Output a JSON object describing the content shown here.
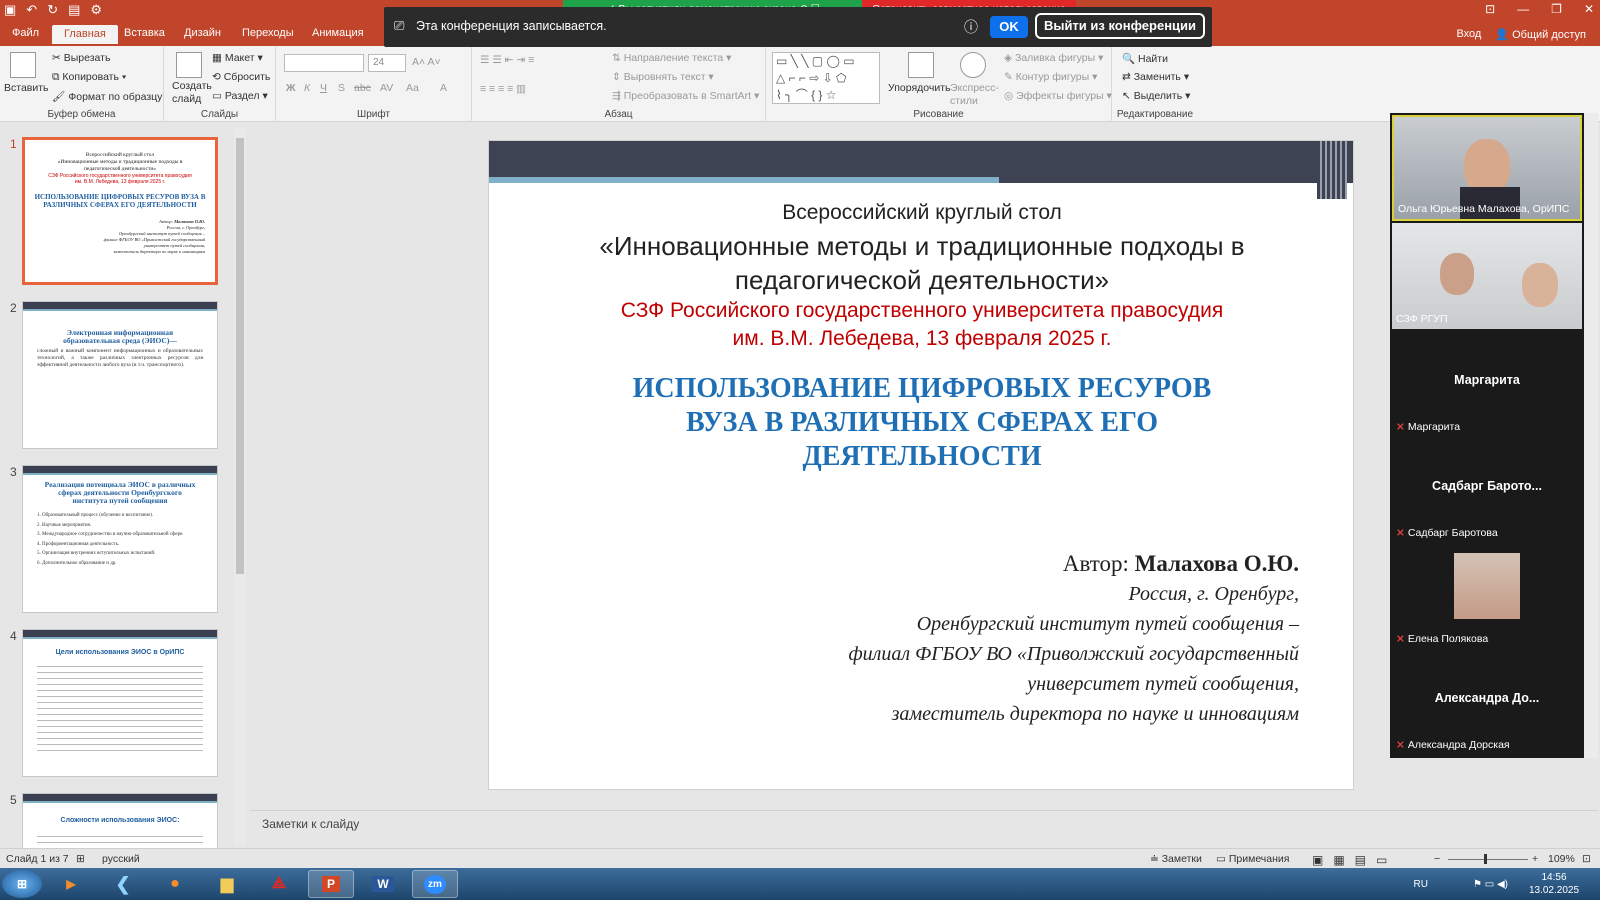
{
  "window": {
    "qat_icons": [
      "save-icon",
      "undo-icon",
      "redo-icon",
      "start-slideshow-icon",
      "customize-icon"
    ],
    "controls": [
      "ribbon-display-icon",
      "minimize-icon",
      "maximize-icon",
      "close-icon"
    ]
  },
  "zoom_share": {
    "green_text": "Вы запустили демонстрацию экрана",
    "red_text": "Остановить совместное использование"
  },
  "notice": {
    "text": "Эта конференция записывается.",
    "ok": "OK",
    "leave": "Выйти из конференции"
  },
  "tabs": {
    "file": "Файл",
    "home": "Главная",
    "insert": "Вставка",
    "design": "Дизайн",
    "transitions": "Переходы",
    "animation": "Анимация",
    "signin": "Вход",
    "share": "Общий доступ"
  },
  "ribbon": {
    "clipboard": {
      "label": "Буфер обмена",
      "paste": "Вставить",
      "cut": "Вырезать",
      "copy": "Копировать",
      "format": "Формат по образцу"
    },
    "slides": {
      "label": "Слайды",
      "new_slide": "Создать слайд",
      "layout": "Макет",
      "reset": "Сбросить",
      "section": "Раздел"
    },
    "font": {
      "label": "Шрифт",
      "size": "24",
      "bold": "Ж",
      "italic": "К",
      "underline": "Ч",
      "shadow": "S",
      "strike": "abc",
      "spacing": "AV",
      "case": "Aa"
    },
    "paragraph": {
      "label": "Абзац",
      "direction": "Направление текста",
      "align": "Выровнять текст",
      "smartart": "Преобразовать в SmartArt"
    },
    "drawing": {
      "label": "Рисование",
      "arrange": "Упорядочить",
      "styles": "Экспресс-стили",
      "fill": "Заливка фигуры",
      "outline": "Контур фигуры",
      "effects": "Эффекты фигуры"
    },
    "editing": {
      "label": "Редактирование",
      "find": "Найти",
      "replace": "Заменить",
      "select": "Выделить"
    }
  },
  "thumbnails": [
    {
      "num": "1"
    },
    {
      "num": "2",
      "title": "Электронная информационная образовательная среда (ЭИОС)—",
      "body": "сложный и важный компонент информационных и образовательных технологий, а также различных электронных ресурсов для эффективной деятельности любого вуза (в т.ч. транспортного)."
    },
    {
      "num": "3",
      "title": "Реализация потенциала ЭИОС в различных сферах деятельности Оренбургского института путей сообщения",
      "items": [
        "Образовательный процесс (обучение и воспитание).",
        "Научные мероприятия.",
        "Международное сотрудничество в научно-образовательной сфере.",
        "Профориентационная деятельность.",
        "Организация внутренних вступительных испытаний.",
        "Дополнительное образование и др."
      ]
    },
    {
      "num": "4",
      "title": "Цели использования ЭИОС в ОрИПС"
    },
    {
      "num": "5",
      "title": "Сложности использования ЭИОС:"
    }
  ],
  "slide": {
    "line1": "Всероссийский круглый стол",
    "line2": "«Инновационные методы и традиционные подходы в",
    "line3": "педагогической деятельности»",
    "red1": "СЗФ Российского государственного университета правосудия",
    "red2": "им. В.М. Лебедева, 13 февраля 2025 г.",
    "main1": "ИСПОЛЬЗОВАНИЕ ЦИФРОВЫХ РЕСУРОВ",
    "main2": "ВУЗА В РАЗЛИЧНЫХ СФЕРАХ ЕГО",
    "main3": "ДЕЯТЕЛЬНОСТИ",
    "author_label": "Автор:",
    "author_name": "Малахова О.Ю.",
    "aff1": "Россия, г. Оренбург,",
    "aff2": "Оренбургский институт путей сообщения –",
    "aff3": "филиал ФГБОУ ВО «Приволжский государственный",
    "aff4": "университет путей сообщения,",
    "aff5": "заместитель директора по науке и инновациям"
  },
  "notes_placeholder": "Заметки к слайду",
  "participants": [
    {
      "name": "Ольга Юрьевна Малахова, ОрИПС",
      "video": true
    },
    {
      "name": "СЗФ РГУП",
      "video": true
    },
    {
      "center": "Маргарита",
      "name": "Маргарита",
      "muted": true
    },
    {
      "center": "Садбарг  Барото...",
      "name": "Садбарг Баротова",
      "muted": true
    },
    {
      "name": "Елена Полякова",
      "muted": true,
      "video": true
    },
    {
      "center": "Александра  До...",
      "name": "Александра Дорская",
      "muted": true
    }
  ],
  "status": {
    "slide": "Слайд 1 из 7",
    "lang": "русский",
    "notes": "Заметки",
    "comments": "Примечания",
    "zoom": "109%"
  },
  "taskbar": {
    "apps": [
      "start-orb-icon",
      "media-player-icon",
      "kleopatra-icon",
      "firefox-icon",
      "explorer-icon",
      "acrobat-icon",
      "powerpoint-icon",
      "word-icon",
      "zoom-icon"
    ],
    "lang": "RU",
    "time": "14:56",
    "date": "13.02.2025"
  },
  "colors": {
    "accent": "#c0452b",
    "slide_title": "#1f6fb5",
    "slide_red": "#c00000",
    "thumb_sel": "#e8643b"
  }
}
